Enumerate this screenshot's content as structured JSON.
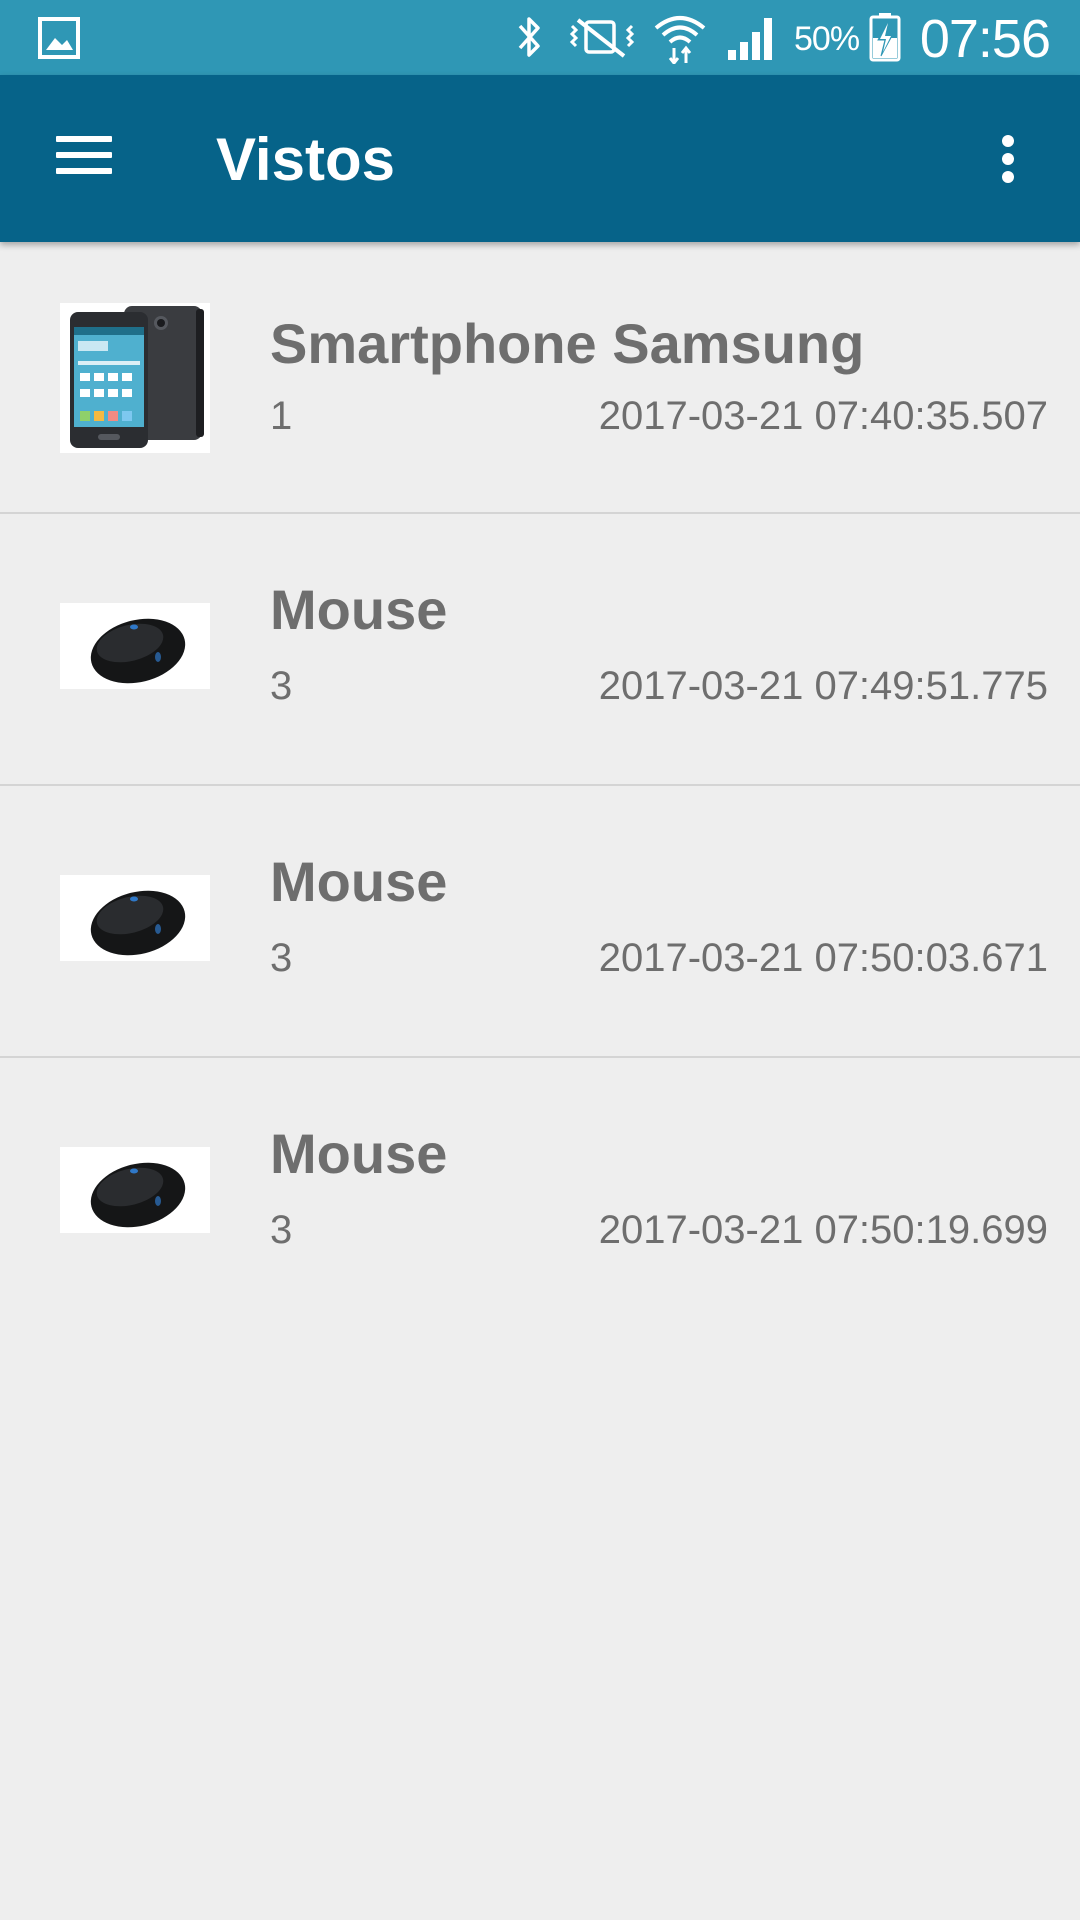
{
  "status_bar": {
    "battery_percent": "50%",
    "time": "07:56",
    "icons": [
      "gallery-icon",
      "bluetooth-icon",
      "vibrate-mute-icon",
      "wifi-icon",
      "cell-signal-icon",
      "battery-charging-icon"
    ]
  },
  "app_bar": {
    "title": "Vistos",
    "menu_icon": "hamburger-menu-icon",
    "overflow_icon": "more-vert-icon"
  },
  "colors": {
    "status_bar": "#2f97b5",
    "app_bar": "#066389",
    "background": "#eeeeee",
    "text": "#6e6e6e",
    "divider": "#d4d4d4"
  },
  "items": [
    {
      "name": "Smartphone Samsung",
      "quantity": "1",
      "date": "2017-03-21 07:40:35.507",
      "thumbnail": "smartphone-image"
    },
    {
      "name": "Mouse",
      "quantity": "3",
      "date": "2017-03-21 07:49:51.775",
      "thumbnail": "mouse-image"
    },
    {
      "name": "Mouse",
      "quantity": "3",
      "date": "2017-03-21 07:50:03.671",
      "thumbnail": "mouse-image"
    },
    {
      "name": "Mouse",
      "quantity": "3",
      "date": "2017-03-21 07:50:19.699",
      "thumbnail": "mouse-image"
    }
  ]
}
